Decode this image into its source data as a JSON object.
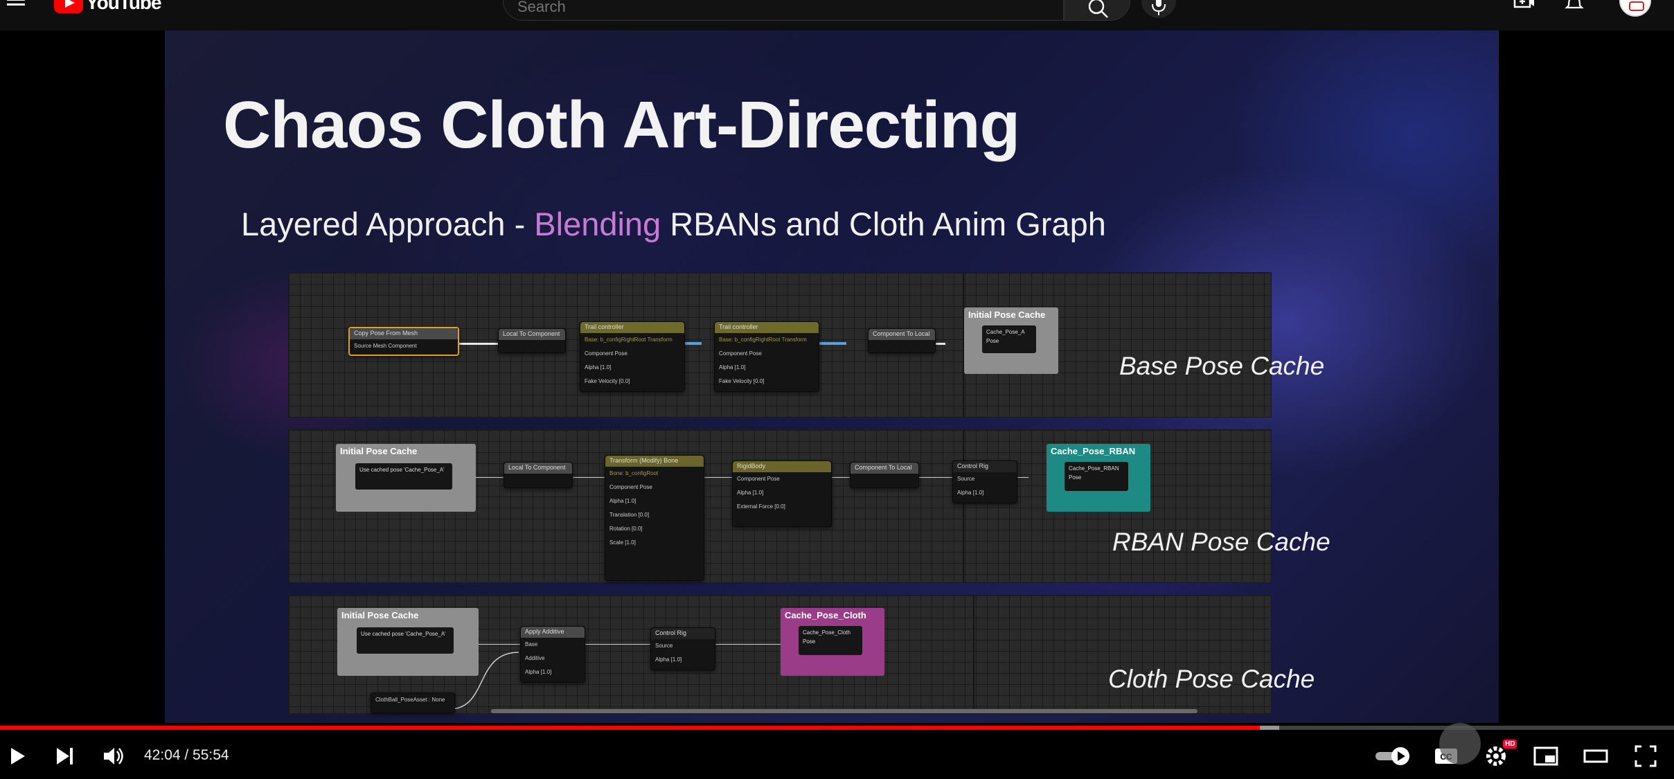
{
  "topbar": {
    "logo_text": "YouTube",
    "search_placeholder": "Search",
    "icons": [
      "menu-icon",
      "youtube-logo-icon",
      "search-icon",
      "mic-icon",
      "create-icon",
      "bell-icon",
      "avatar"
    ]
  },
  "slide": {
    "title": "Chaos Cloth Art-Directing",
    "subtitle_pre": "Layered Approach - ",
    "subtitle_highlight": "Blending",
    "subtitle_post": " RBANs and Cloth Anim Graph",
    "highlight_color": "#c97ad6",
    "captions": {
      "base": "Base Pose Cache",
      "rban": "RBAN Pose Cache",
      "cloth": "Cloth Pose Cache"
    },
    "panel1": {
      "copy_pose_title": "Copy Pose From Mesh",
      "copy_pose_pin": "Source Mesh Component",
      "local_to_component": "Local To Component",
      "trail1_title": "Trail controller",
      "trail1_sub": "Base: b_configRightRoot Transform",
      "trail2_title": "Trail controller",
      "trail2_sub": "Base: b_configRightRoot Transform",
      "component_pose": "Component Pose",
      "alpha": "Alpha",
      "alpha_val": "1.0",
      "fake_velocity": "Fake Velocity",
      "vec_val": "0.0",
      "component_to_local": "Component To Local",
      "cache_title": "Initial Pose Cache",
      "cache_inner": "Cache_Pose_A",
      "pose": "Pose"
    },
    "panel2": {
      "cache_title": "Initial Pose Cache",
      "use_cached": "Use cached pose 'Cache_Pose_A'",
      "local_to_component": "Local To Component",
      "transform_title": "Transform (Modify) Bone",
      "transform_sub": "Bone: b_configRoot",
      "component_pose": "Component Pose",
      "alpha": "Alpha",
      "alpha_val": "1.0",
      "translation": "Translation",
      "rotation": "Rotation",
      "scale": "Scale",
      "vec_val": "0.0",
      "scale_val": "1.0",
      "rigidbody_title": "RigidBody",
      "external_force": "External Force",
      "component_to_local": "Component To Local",
      "control_rig": "Control Rig",
      "source": "Source",
      "rban_cache_title": "Cache_Pose_RBAN",
      "rban_inner": "Cache_Pose_RBAN",
      "pose": "Pose"
    },
    "panel3": {
      "cache_title": "Initial Pose Cache",
      "use_cached": "Use cached pose 'Cache_Pose_A'",
      "apply_additive": "Apply Additive",
      "base": "Base",
      "additive": "Additive",
      "alpha": "Alpha",
      "alpha_val": "1.0",
      "control_rig": "Control Rig",
      "source": "Source",
      "cloth_cache_title": "Cache_Pose_Cloth",
      "cloth_inner": "Cache_Pose_Cloth",
      "pose": "Pose",
      "pose_asset": "ClothBall_PoseAsset : None"
    }
  },
  "player": {
    "time": "42:04 / 55:54",
    "progress_fraction": 0.7525,
    "buffer_fraction": 0.764,
    "hd_badge": "HD",
    "accent": "#ff0000"
  }
}
